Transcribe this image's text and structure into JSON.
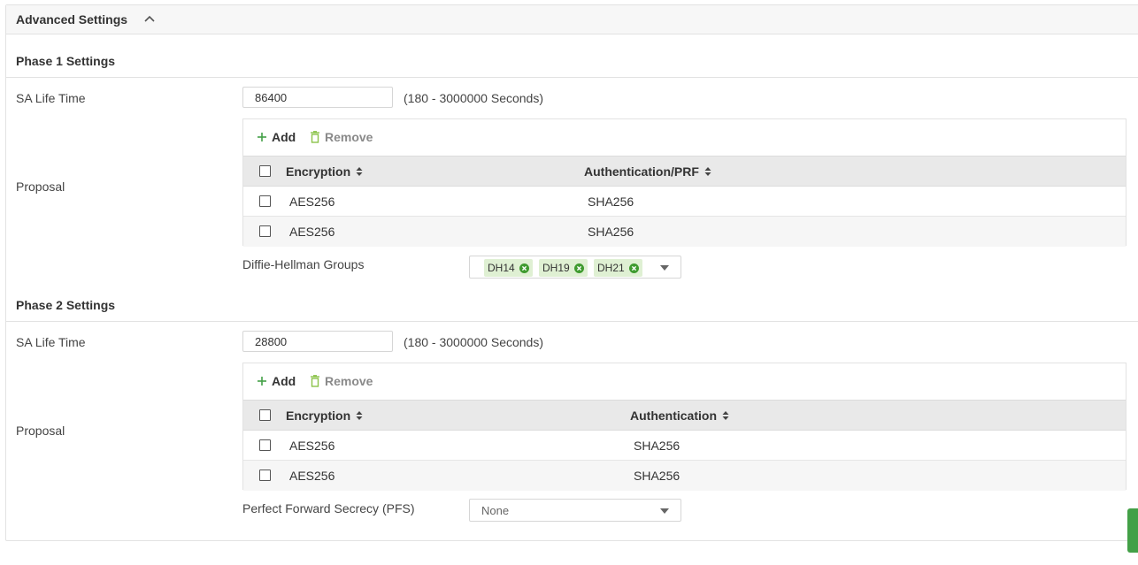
{
  "panel": {
    "title": "Advanced Settings"
  },
  "phase1": {
    "title": "Phase 1 Settings",
    "sa_life_time_label": "SA Life Time",
    "sa_life_time_value": "86400",
    "sa_life_time_hint": "(180 - 3000000 Seconds)",
    "proposal_label": "Proposal",
    "add_label": "Add",
    "remove_label": "Remove",
    "columns": [
      "Encryption",
      "Authentication/PRF"
    ],
    "rows": [
      {
        "encryption": "AES256",
        "auth": "SHA256"
      },
      {
        "encryption": "AES256",
        "auth": "SHA256"
      }
    ],
    "dh_label": "Diffie-Hellman Groups",
    "dh_groups": [
      "DH14",
      "DH19",
      "DH21"
    ]
  },
  "phase2": {
    "title": "Phase 2 Settings",
    "sa_life_time_label": "SA Life Time",
    "sa_life_time_value": "28800",
    "sa_life_time_hint": "(180 - 3000000 Seconds)",
    "proposal_label": "Proposal",
    "add_label": "Add",
    "remove_label": "Remove",
    "columns": [
      "Encryption",
      "Authentication"
    ],
    "rows": [
      {
        "encryption": "AES256",
        "auth": "SHA256"
      },
      {
        "encryption": "AES256",
        "auth": "SHA256"
      }
    ],
    "pfs_label": "Perfect Forward Secrecy (PFS)",
    "pfs_value": "None"
  },
  "colors": {
    "accent_green": "#43a047",
    "chip_bg": "#dff0d3",
    "header_bg": "#e9e9e9"
  }
}
